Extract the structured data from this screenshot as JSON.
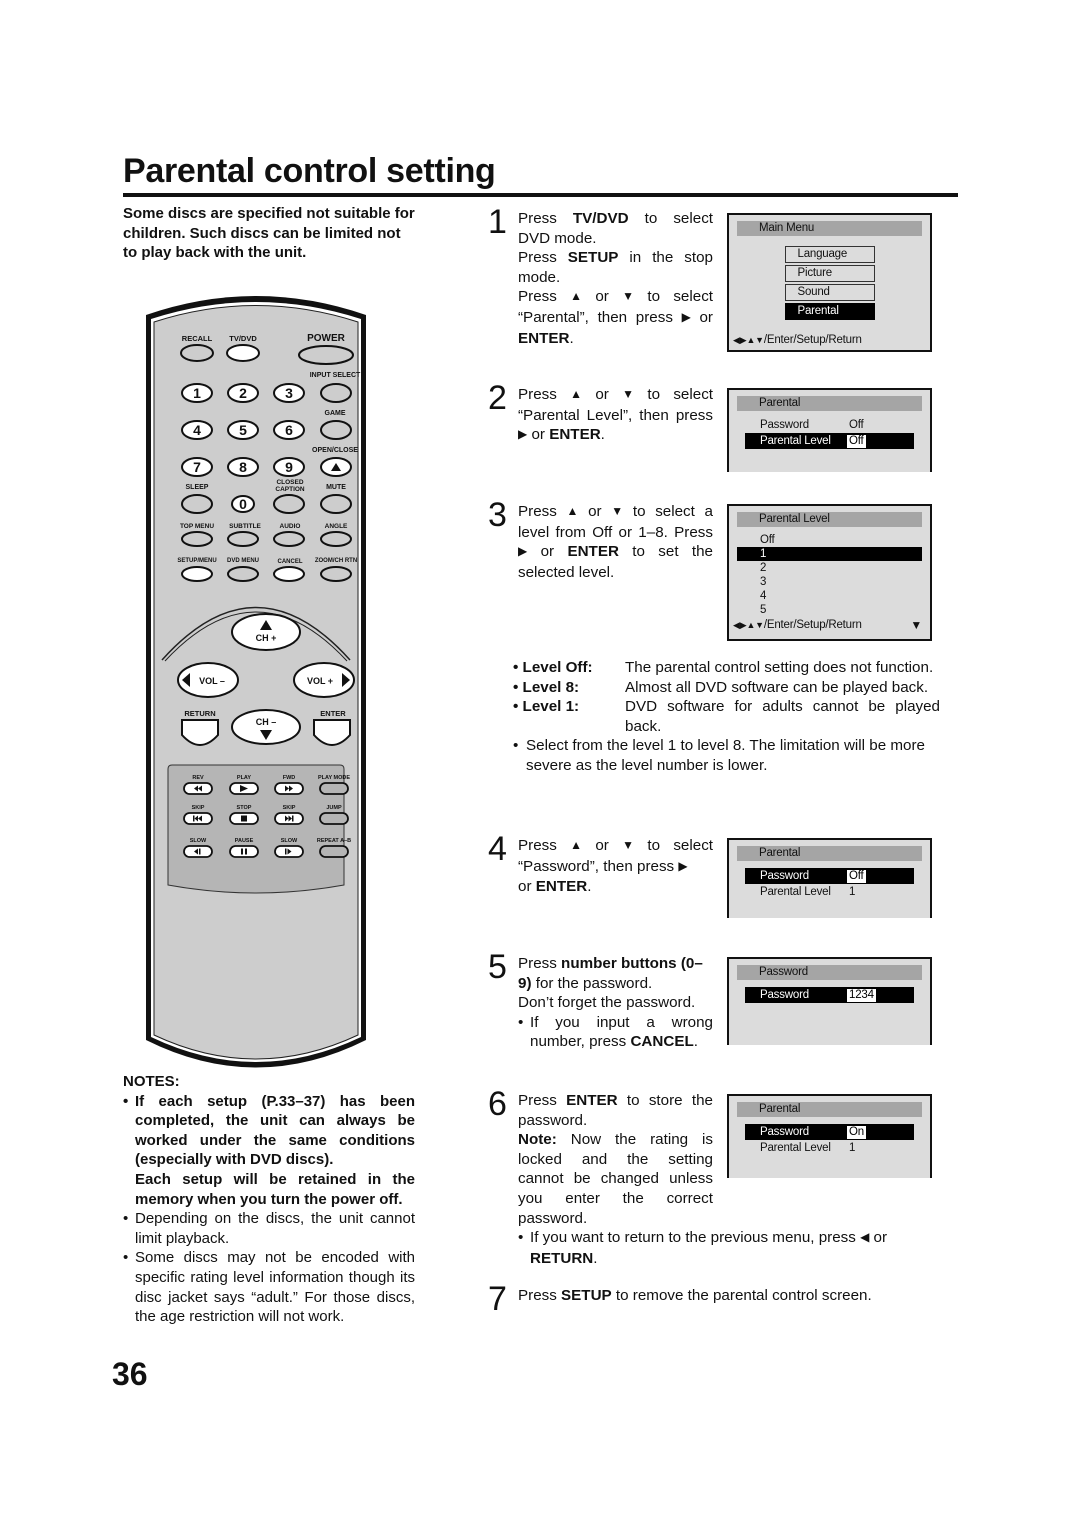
{
  "page": {
    "title": "Parental control setting",
    "intro": "Some discs are specified not suitable for children. Such discs can be limited not to play back with the unit.",
    "page_number": "36"
  },
  "remote": {
    "top_row": [
      "RECALL",
      "TV/DVD",
      "POWER"
    ],
    "side_labels": [
      "INPUT SELECT",
      "GAME",
      "OPEN/CLOSE"
    ],
    "digits": [
      "1",
      "2",
      "3",
      "4",
      "5",
      "6",
      "7",
      "8",
      "9",
      "0"
    ],
    "row4": [
      "SLEEP",
      "CLOSED",
      "CAPTION",
      "MUTE"
    ],
    "row5": [
      "TOP MENU",
      "SUBTITLE",
      "AUDIO",
      "ANGLE"
    ],
    "row6": [
      "SETUP/MENU",
      "DVD MENU",
      "CANCEL",
      "ZOOM/CH RTN"
    ],
    "nav": [
      "CH +",
      "VOL –",
      "VOL +",
      "CH –",
      "RETURN",
      "ENTER"
    ],
    "transport_labels": [
      "REV",
      "PLAY",
      "FWD",
      "PLAY MODE",
      "SKIP",
      "STOP",
      "SKIP",
      "JUMP",
      "SLOW",
      "PAUSE",
      "SLOW",
      "REPEAT A–B"
    ]
  },
  "notes": {
    "heading": "NOTES:",
    "item1_bold": "If each setup (P.33–37) has been completed, the unit can always be worked under the same conditions (especially with DVD discs).",
    "item1_bold2": "Each setup will be retained in the memory when you turn the power off.",
    "item2": "Depending on the discs, the unit cannot limit playback.",
    "item3": "Some discs may not be encoded with specific rating level information though its disc jacket says “adult.” For those discs, the age restriction will not work."
  },
  "steps": {
    "s1": {
      "num": "1",
      "a": "Press ",
      "a_b": "TV/DVD",
      "a2": " to select DVD mode.",
      "b": "Press ",
      "b_b": "SETUP",
      "b2": " in the stop mode.",
      "c": "Press ",
      "c_or": " or ",
      "c2": " to select “Parental”, then press ",
      "c3": " or ",
      "c_b": "ENTER",
      "c4": "."
    },
    "s2": {
      "num": "2",
      "a": "Press ",
      "a_or": " or ",
      "a2": " to select “Parental Level”, then press ",
      "a3": " or ",
      "a_b": "ENTER",
      "a4": "."
    },
    "s3": {
      "num": "3",
      "a": "Press ",
      "a_or": " or ",
      "a2": " to select a level from Off or 1–8. Press ",
      "a3": " or ",
      "a_b": "ENTER",
      "a4": " to set the selected level."
    },
    "s4": {
      "num": "4",
      "a": "Press ",
      "a_or": " or ",
      "a2": " to select “Password”, then press ",
      "a3": " or ",
      "a_b": "ENTER",
      "a4": "."
    },
    "s5": {
      "num": "5",
      "a": "Press ",
      "a_b": "number buttons (0–9)",
      "a2": " for the password.",
      "b": "Don’t forget the password.",
      "c": "If you input a wrong number, press ",
      "c_b": "CANCEL",
      "c2": "."
    },
    "s6": {
      "num": "6",
      "a": "Press ",
      "a_b": "ENTER",
      "a2": " to store the password.",
      "note_b": "Note:",
      "note": " Now the rating is locked and the setting cannot be changed unless you enter the correct password."
    },
    "s7": {
      "num": "7",
      "a": "Press ",
      "a_b": "SETUP",
      "a2": " to remove the parental control screen."
    }
  },
  "levels": [
    {
      "label": "Level Off:",
      "text": "The parental control setting does not function."
    },
    {
      "label": "Level 8:",
      "text": "Almost all DVD software can be played back."
    },
    {
      "label": "Level 1:",
      "text": "DVD software for adults cannot be played back."
    }
  ],
  "levels_note": "Select from the level 1 to level 8. The limitation will be more severe as the level number is lower.",
  "return_note": {
    "a": "If you want to return to the previous menu, press ",
    "a2": " or ",
    "a_b": "RETURN",
    "a3": "."
  },
  "symbols": {
    "up": "▲",
    "down": "▼",
    "right": "▶",
    "left": "◀",
    "nav_hint": "◀▶▲▼"
  },
  "osd": {
    "main_menu": {
      "header": "Main Menu",
      "items": [
        "Language",
        "Picture",
        "Sound",
        "Parental"
      ],
      "selected": "Parental",
      "footer": "/Enter/Setup/Return"
    },
    "parental_1": {
      "header": "Parental",
      "rows": [
        {
          "label": "Password",
          "value": "Off"
        },
        {
          "label": "Parental Level",
          "value": "Off"
        }
      ],
      "selected": "Parental Level"
    },
    "parental_level": {
      "header": "Parental Level",
      "options": [
        "Off",
        "1",
        "2",
        "3",
        "4",
        "5"
      ],
      "selected": "1",
      "footer": "/Enter/Setup/Return",
      "more": "▼"
    },
    "parental_2": {
      "header": "Parental",
      "rows": [
        {
          "label": "Password",
          "value": "Off"
        },
        {
          "label": "Parental Level",
          "value": "1"
        }
      ],
      "selected": "Password"
    },
    "password": {
      "header": "Password",
      "label": "Password",
      "value": "1234"
    },
    "parental_3": {
      "header": "Parental",
      "rows": [
        {
          "label": "Password",
          "value": "On"
        },
        {
          "label": "Parental Level",
          "value": "1"
        }
      ],
      "selected": "Password"
    }
  }
}
